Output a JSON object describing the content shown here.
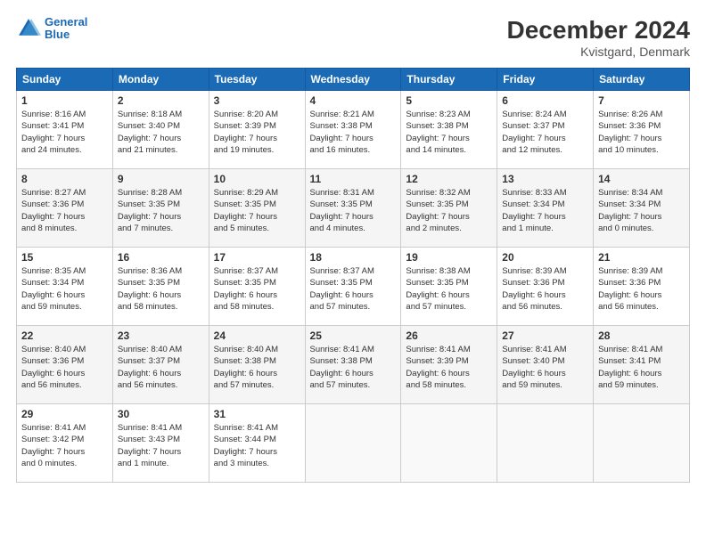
{
  "header": {
    "logo_line1": "General",
    "logo_line2": "Blue",
    "main_title": "December 2024",
    "subtitle": "Kvistgard, Denmark"
  },
  "columns": [
    "Sunday",
    "Monday",
    "Tuesday",
    "Wednesday",
    "Thursday",
    "Friday",
    "Saturday"
  ],
  "weeks": [
    [
      {
        "day": "1",
        "info": "Sunrise: 8:16 AM\nSunset: 3:41 PM\nDaylight: 7 hours\nand 24 minutes."
      },
      {
        "day": "2",
        "info": "Sunrise: 8:18 AM\nSunset: 3:40 PM\nDaylight: 7 hours\nand 21 minutes."
      },
      {
        "day": "3",
        "info": "Sunrise: 8:20 AM\nSunset: 3:39 PM\nDaylight: 7 hours\nand 19 minutes."
      },
      {
        "day": "4",
        "info": "Sunrise: 8:21 AM\nSunset: 3:38 PM\nDaylight: 7 hours\nand 16 minutes."
      },
      {
        "day": "5",
        "info": "Sunrise: 8:23 AM\nSunset: 3:38 PM\nDaylight: 7 hours\nand 14 minutes."
      },
      {
        "day": "6",
        "info": "Sunrise: 8:24 AM\nSunset: 3:37 PM\nDaylight: 7 hours\nand 12 minutes."
      },
      {
        "day": "7",
        "info": "Sunrise: 8:26 AM\nSunset: 3:36 PM\nDaylight: 7 hours\nand 10 minutes."
      }
    ],
    [
      {
        "day": "8",
        "info": "Sunrise: 8:27 AM\nSunset: 3:36 PM\nDaylight: 7 hours\nand 8 minutes."
      },
      {
        "day": "9",
        "info": "Sunrise: 8:28 AM\nSunset: 3:35 PM\nDaylight: 7 hours\nand 7 minutes."
      },
      {
        "day": "10",
        "info": "Sunrise: 8:29 AM\nSunset: 3:35 PM\nDaylight: 7 hours\nand 5 minutes."
      },
      {
        "day": "11",
        "info": "Sunrise: 8:31 AM\nSunset: 3:35 PM\nDaylight: 7 hours\nand 4 minutes."
      },
      {
        "day": "12",
        "info": "Sunrise: 8:32 AM\nSunset: 3:35 PM\nDaylight: 7 hours\nand 2 minutes."
      },
      {
        "day": "13",
        "info": "Sunrise: 8:33 AM\nSunset: 3:34 PM\nDaylight: 7 hours\nand 1 minute."
      },
      {
        "day": "14",
        "info": "Sunrise: 8:34 AM\nSunset: 3:34 PM\nDaylight: 7 hours\nand 0 minutes."
      }
    ],
    [
      {
        "day": "15",
        "info": "Sunrise: 8:35 AM\nSunset: 3:34 PM\nDaylight: 6 hours\nand 59 minutes."
      },
      {
        "day": "16",
        "info": "Sunrise: 8:36 AM\nSunset: 3:35 PM\nDaylight: 6 hours\nand 58 minutes."
      },
      {
        "day": "17",
        "info": "Sunrise: 8:37 AM\nSunset: 3:35 PM\nDaylight: 6 hours\nand 58 minutes."
      },
      {
        "day": "18",
        "info": "Sunrise: 8:37 AM\nSunset: 3:35 PM\nDaylight: 6 hours\nand 57 minutes."
      },
      {
        "day": "19",
        "info": "Sunrise: 8:38 AM\nSunset: 3:35 PM\nDaylight: 6 hours\nand 57 minutes."
      },
      {
        "day": "20",
        "info": "Sunrise: 8:39 AM\nSunset: 3:36 PM\nDaylight: 6 hours\nand 56 minutes."
      },
      {
        "day": "21",
        "info": "Sunrise: 8:39 AM\nSunset: 3:36 PM\nDaylight: 6 hours\nand 56 minutes."
      }
    ],
    [
      {
        "day": "22",
        "info": "Sunrise: 8:40 AM\nSunset: 3:36 PM\nDaylight: 6 hours\nand 56 minutes."
      },
      {
        "day": "23",
        "info": "Sunrise: 8:40 AM\nSunset: 3:37 PM\nDaylight: 6 hours\nand 56 minutes."
      },
      {
        "day": "24",
        "info": "Sunrise: 8:40 AM\nSunset: 3:38 PM\nDaylight: 6 hours\nand 57 minutes."
      },
      {
        "day": "25",
        "info": "Sunrise: 8:41 AM\nSunset: 3:38 PM\nDaylight: 6 hours\nand 57 minutes."
      },
      {
        "day": "26",
        "info": "Sunrise: 8:41 AM\nSunset: 3:39 PM\nDaylight: 6 hours\nand 58 minutes."
      },
      {
        "day": "27",
        "info": "Sunrise: 8:41 AM\nSunset: 3:40 PM\nDaylight: 6 hours\nand 59 minutes."
      },
      {
        "day": "28",
        "info": "Sunrise: 8:41 AM\nSunset: 3:41 PM\nDaylight: 6 hours\nand 59 minutes."
      }
    ],
    [
      {
        "day": "29",
        "info": "Sunrise: 8:41 AM\nSunset: 3:42 PM\nDaylight: 7 hours\nand 0 minutes."
      },
      {
        "day": "30",
        "info": "Sunrise: 8:41 AM\nSunset: 3:43 PM\nDaylight: 7 hours\nand 1 minute."
      },
      {
        "day": "31",
        "info": "Sunrise: 8:41 AM\nSunset: 3:44 PM\nDaylight: 7 hours\nand 3 minutes."
      },
      null,
      null,
      null,
      null
    ]
  ]
}
